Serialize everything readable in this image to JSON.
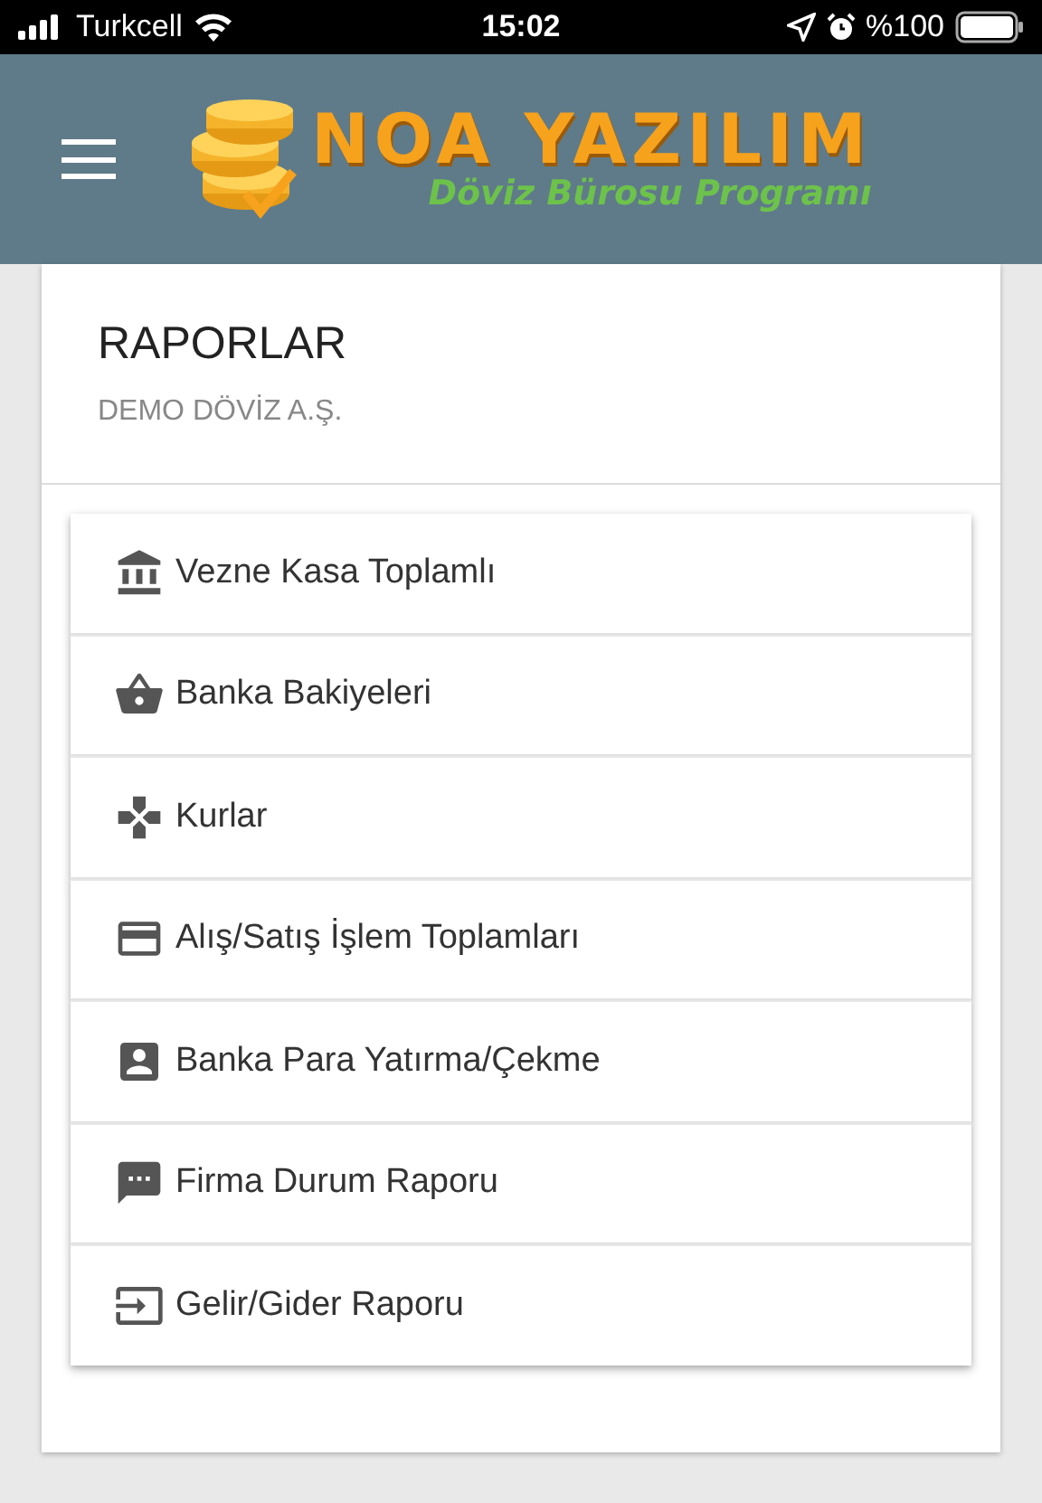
{
  "status_bar": {
    "carrier": "Turkcell",
    "time": "15:02",
    "battery": "%100"
  },
  "header": {
    "logo_title": "NOA YAZILIM",
    "logo_subtitle": "Döviz Bürosu Programı"
  },
  "card": {
    "title": "RAPORLAR",
    "subtitle": "DEMO DÖVİZ A.Ş."
  },
  "menu_items": [
    {
      "label": "Vezne Kasa Toplamlı"
    },
    {
      "label": "Banka Bakiyeleri"
    },
    {
      "label": "Kurlar"
    },
    {
      "label": "Alış/Satış İşlem Toplamları"
    },
    {
      "label": "Banka Para Yatırma/Çekme"
    },
    {
      "label": "Firma Durum Raporu"
    },
    {
      "label": "Gelir/Gider Raporu"
    }
  ]
}
